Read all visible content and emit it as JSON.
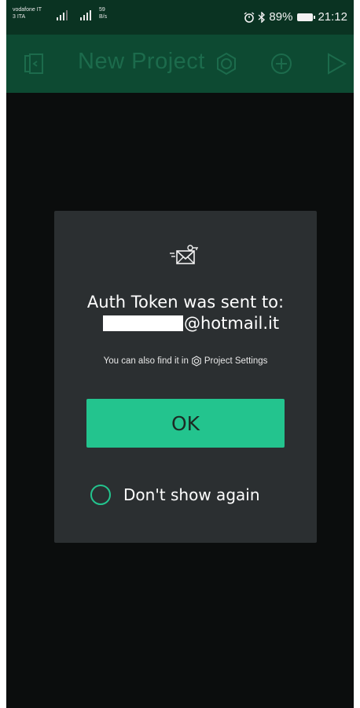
{
  "status_bar": {
    "carrier_line1": "vodafone IT",
    "carrier_line2": "3 ITA",
    "net_speed_value": "59",
    "net_speed_unit": "B/s",
    "battery_percent": "89%",
    "time": "21:12",
    "icons": [
      "signal-icon",
      "signal-icon",
      "alarm-icon",
      "bluetooth-icon",
      "battery-icon"
    ]
  },
  "app_bar": {
    "title": "New Project",
    "icons": [
      "back-to-projects-icon",
      "settings-icon",
      "add-widget-icon",
      "play-icon"
    ]
  },
  "dialog": {
    "icon": "mail-key-icon",
    "headline": "Auth Token was sent to:",
    "email_domain": "@hotmail.it",
    "hint_prefix": "You can also find it in",
    "hint_link": "Project Settings",
    "ok_label": "OK",
    "dont_show_label": "Don't show again"
  },
  "colors": {
    "accent": "#23c48e",
    "app_bar": "#0d4a32",
    "dialog_bg": "#2b2f31",
    "background": "#0b0d0d"
  }
}
